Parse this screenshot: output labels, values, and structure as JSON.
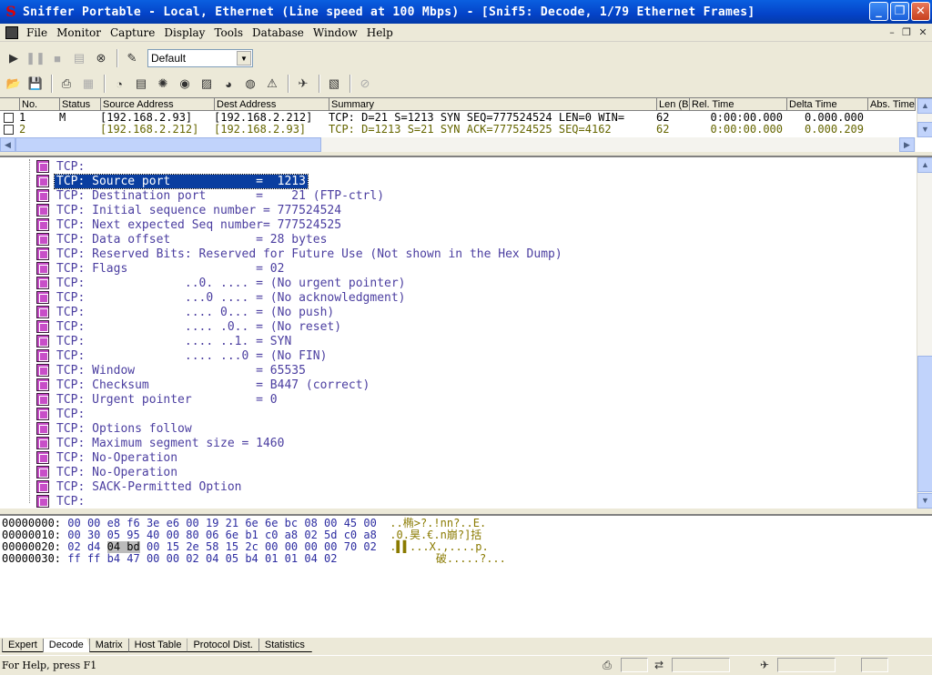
{
  "window": {
    "title": "Sniffer Portable - Local, Ethernet (Line speed at 100 Mbps) - [Snif5: Decode, 1/79 Ethernet Frames]",
    "app_icon": "S"
  },
  "menu": [
    "File",
    "Monitor",
    "Capture",
    "Display",
    "Tools",
    "Database",
    "Window",
    "Help"
  ],
  "toolbar": {
    "profile_value": "Default"
  },
  "summary": {
    "columns": [
      "No.",
      "Status",
      "Source Address",
      "Dest Address",
      "Summary",
      "Len (B",
      "Rel. Time",
      "Delta Time",
      "Abs. Time"
    ],
    "rows": [
      {
        "no": "1",
        "status": "M",
        "src": "[192.168.2.93]",
        "dst": "[192.168.2.212]",
        "summary": "TCP: D=21 S=1213 SYN SEQ=777524524 LEN=0 WIN=",
        "len": "62",
        "rel": "0:00:00.000",
        "delta": "0.000.000",
        "abs": ""
      },
      {
        "no": "2",
        "status": "",
        "src": "[192.168.2.212]",
        "dst": "[192.168.2.93]",
        "summary": "TCP: D=1213 S=21 SYN ACK=777524525 SEQ=4162",
        "len": "62",
        "rel": "0:00:00.000",
        "delta": "0.000.209",
        "abs": ""
      }
    ]
  },
  "decode": {
    "lines": [
      "TCP:",
      "TCP: Source port            =  1213",
      "TCP: Destination port       =    21 (FTP-ctrl)",
      "TCP: Initial sequence number = 777524524",
      "TCP: Next expected Seq number= 777524525",
      "TCP: Data offset            = 28 bytes",
      "TCP: Reserved Bits: Reserved for Future Use (Not shown in the Hex Dump)",
      "TCP: Flags                  = 02",
      "TCP:              ..0. .... = (No urgent pointer)",
      "TCP:              ...0 .... = (No acknowledgment)",
      "TCP:              .... 0... = (No push)",
      "TCP:              .... .0.. = (No reset)",
      "TCP:              .... ..1. = SYN",
      "TCP:              .... ...0 = (No FIN)",
      "TCP: Window                 = 65535",
      "TCP: Checksum               = B447 (correct)",
      "TCP: Urgent pointer         = 0",
      "TCP:",
      "TCP: Options follow",
      "TCP: Maximum segment size = 1460",
      "TCP: No-Operation",
      "TCP: No-Operation",
      "TCP: SACK-Permitted Option",
      "TCP:"
    ]
  },
  "hex": {
    "rows": [
      {
        "offset": "00000000:",
        "bytes_a": "00 00 e8 f6 3e e6 00 19 21 6e 6e bc 08 00 45 00",
        "hl": "",
        "bytes_b": "",
        "ascii": "..椭>?.!nn?..E."
      },
      {
        "offset": "00000010:",
        "bytes_a": "00 30 05 95 40 00 80 06 6e b1 c0 a8 02 5d c0 a8",
        "hl": "",
        "bytes_b": "",
        "ascii": ".0.昊.€.n崩?]括"
      },
      {
        "offset": "00000020:",
        "bytes_a": "02 d4 ",
        "hl": "04 bd",
        "bytes_b": " 00 15 2e 58 15 2c 00 00 00 00 70 02",
        "ascii": ".▌▌...X.,....p."
      },
      {
        "offset": "00000030:",
        "bytes_a": "ff ff b4 47 00 00 02 04 05 b4 01 01 04 02",
        "hl": "",
        "bytes_b": "",
        "ascii": "       破.....?..."
      }
    ]
  },
  "tabs": [
    "Expert",
    "Decode",
    "Matrix",
    "Host Table",
    "Protocol Dist.",
    "Statistics"
  ],
  "status": {
    "help_text": "For Help, press F1"
  }
}
